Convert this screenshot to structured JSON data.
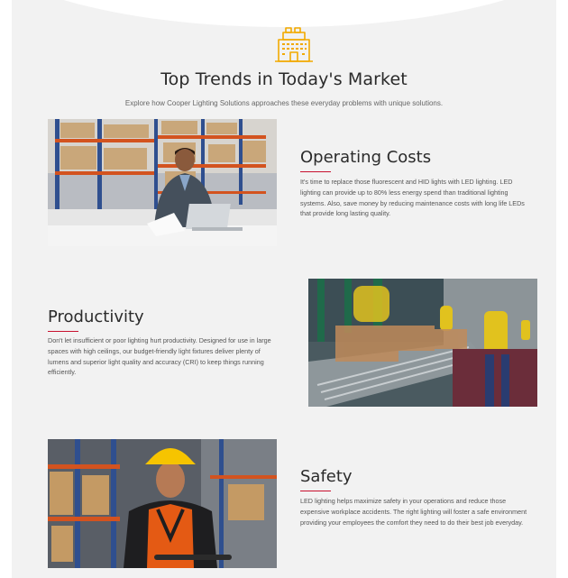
{
  "header": {
    "icon": "factory-building-icon",
    "title": "Top Trends in Today's Market",
    "subtitle": "Explore how Cooper Lighting Solutions approaches these everyday problems with unique solutions."
  },
  "colors": {
    "background": "#f2f2f2",
    "accent_icon": "#f2a900",
    "accent_rule": "#c8102e"
  },
  "blocks": [
    {
      "title": "Operating Costs",
      "text": "It's time to replace those fluorescent and HID lights with LED lighting. LED lighting can provide up to 80% less energy spend than traditional lighting systems. Also, save money by reducing maintenance costs with long life LEDs that provide long lasting quality.",
      "image": "warehouse-worker-laptop-photo"
    },
    {
      "title": "Productivity",
      "text": "Don't let insufficient or poor lighting hurt productivity. Designed for use in large spaces with high ceilings, our budget-friendly light fixtures deliver plenty of lumens and superior light quality and accuracy (CRI) to keep things running efficiently.",
      "image": "conveyor-belt-boxes-photo"
    },
    {
      "title": "Safety",
      "text": "LED lighting helps maximize safety in your operations and reduce those expensive workplace accidents. The right lighting will foster a safe environment providing your employees the comfort they need to do their best job everyday.",
      "image": "worker-hardhat-vest-photo"
    }
  ]
}
